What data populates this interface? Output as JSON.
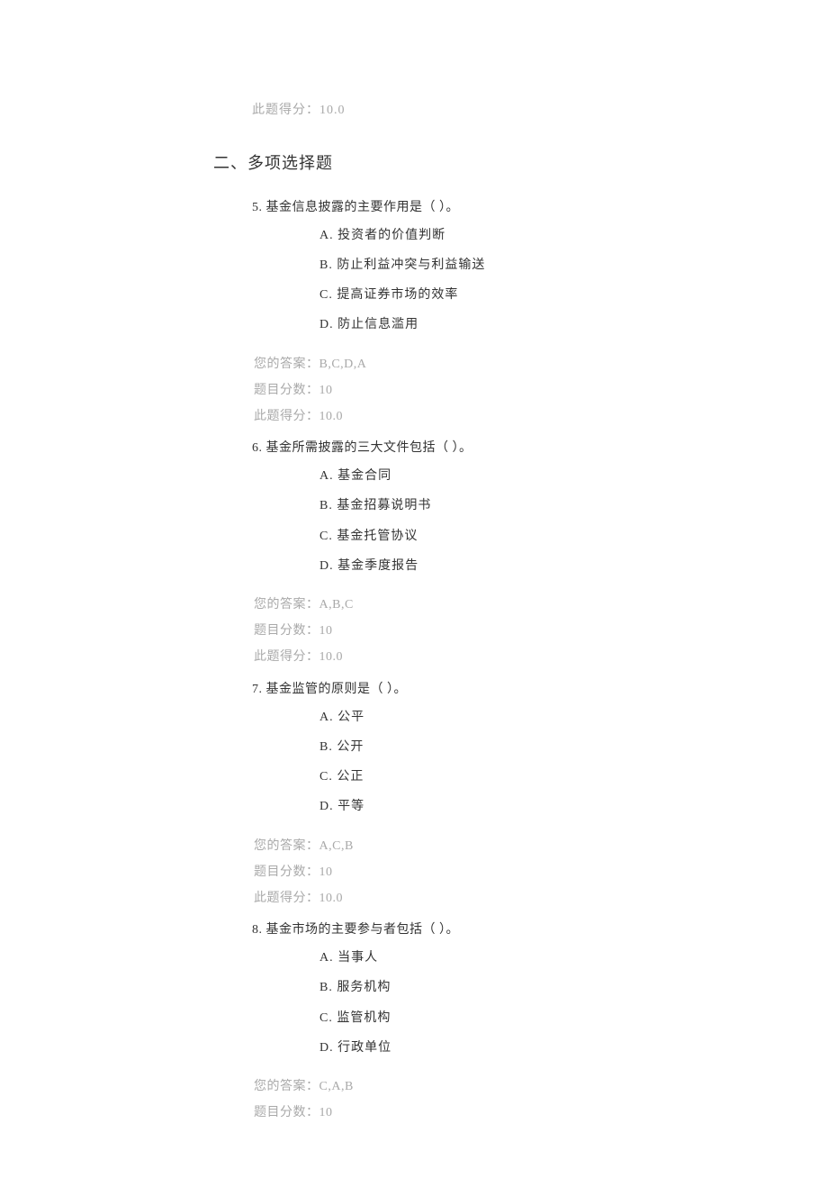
{
  "top_score_line": "此题得分：10.0",
  "section_title": "二、多项选择题",
  "questions": [
    {
      "number": "5.",
      "stem": "基金信息披露的主要作用是（ ）。",
      "options": [
        {
          "label": "A.",
          "text": "投资者的价值判断"
        },
        {
          "label": "B.",
          "text": "防止利益冲突与利益输送"
        },
        {
          "label": "C.",
          "text": "提高证券市场的效率"
        },
        {
          "label": "D.",
          "text": "防止信息滥用"
        }
      ],
      "your_answer_label": "您的答案：",
      "your_answer_value": "B,C,D,A",
      "question_score_label": "题目分数：",
      "question_score_value": "10",
      "obtained_score_label": "此题得分：",
      "obtained_score_value": "10.0"
    },
    {
      "number": "6.",
      "stem": "基金所需披露的三大文件包括（ ）。",
      "options": [
        {
          "label": "A.",
          "text": "基金合同"
        },
        {
          "label": "B.",
          "text": "基金招募说明书"
        },
        {
          "label": "C.",
          "text": "基金托管协议"
        },
        {
          "label": "D.",
          "text": "基金季度报告"
        }
      ],
      "your_answer_label": "您的答案：",
      "your_answer_value": "A,B,C",
      "question_score_label": "题目分数：",
      "question_score_value": "10",
      "obtained_score_label": "此题得分：",
      "obtained_score_value": "10.0"
    },
    {
      "number": "7.",
      "stem": "基金监管的原则是（ ）。",
      "options": [
        {
          "label": "A.",
          "text": "公平"
        },
        {
          "label": "B.",
          "text": "公开"
        },
        {
          "label": "C.",
          "text": "公正"
        },
        {
          "label": "D.",
          "text": "平等"
        }
      ],
      "your_answer_label": "您的答案：",
      "your_answer_value": "A,C,B",
      "question_score_label": "题目分数：",
      "question_score_value": "10",
      "obtained_score_label": "此题得分：",
      "obtained_score_value": "10.0"
    },
    {
      "number": "8.",
      "stem": "基金市场的主要参与者包括（ ）。",
      "options": [
        {
          "label": "A.",
          "text": "当事人"
        },
        {
          "label": "B.",
          "text": "服务机构"
        },
        {
          "label": "C.",
          "text": "监管机构"
        },
        {
          "label": "D.",
          "text": "行政单位"
        }
      ],
      "your_answer_label": "您的答案：",
      "your_answer_value": "C,A,B",
      "question_score_label": "题目分数：",
      "question_score_value": "10",
      "obtained_score_label": "此题得分：",
      "obtained_score_value": ""
    }
  ]
}
